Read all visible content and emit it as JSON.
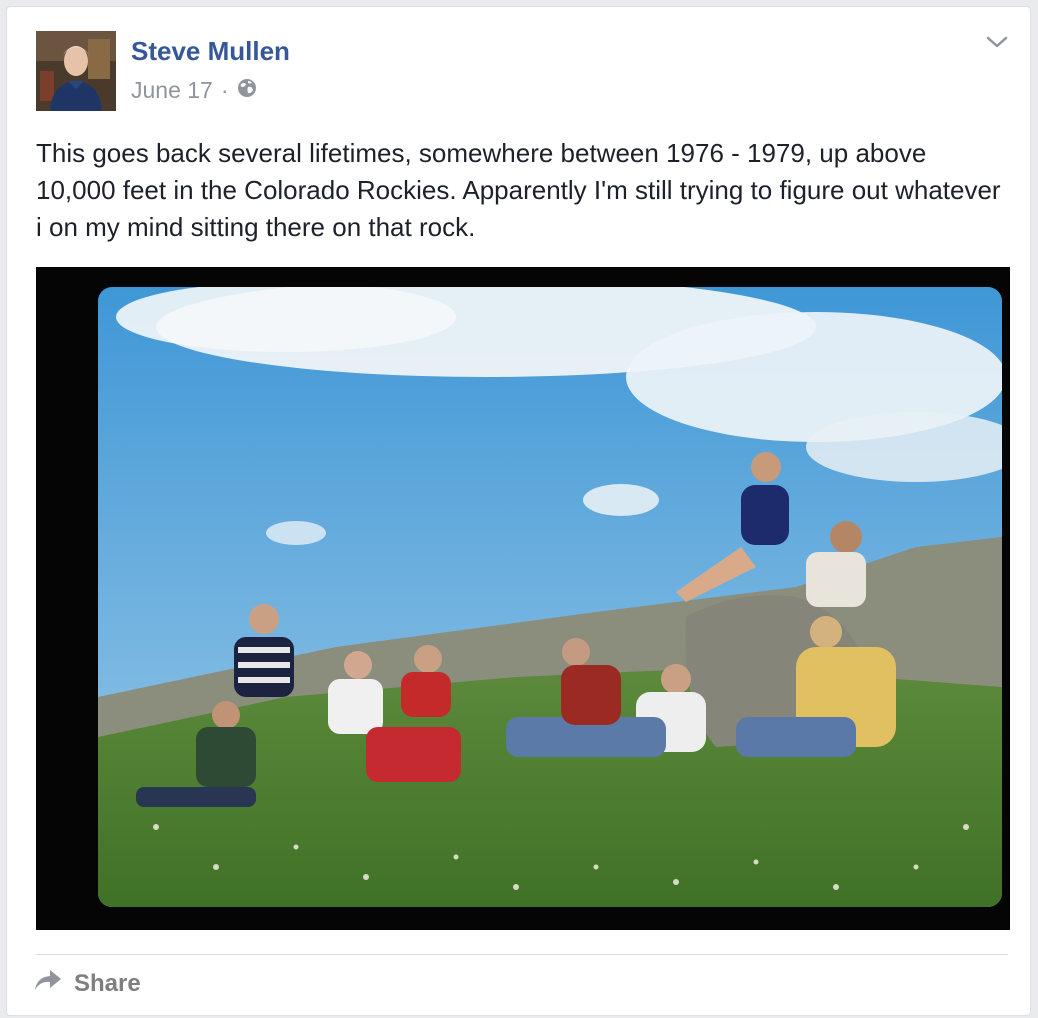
{
  "post": {
    "author": "Steve Mullen",
    "date": "June 17",
    "separator": "·",
    "privacy_icon": "globe-icon",
    "menu_icon": "chevron-down-icon",
    "text": "This goes back several lifetimes, somewhere between 1976 - 1979, up above 10,000 feet in the Colorado Rockies. Apparently I'm still trying to figure out whatever i on my mind sitting there on that rock.",
    "photo_subject": "group of hikers sitting on a grassy alpine slope under a blue sky"
  },
  "actions": {
    "share_label": "Share",
    "share_icon": "share-arrow-icon"
  },
  "colors": {
    "author_link": "#365899",
    "meta_text": "#90949c",
    "action_text": "#7f7f7f"
  }
}
